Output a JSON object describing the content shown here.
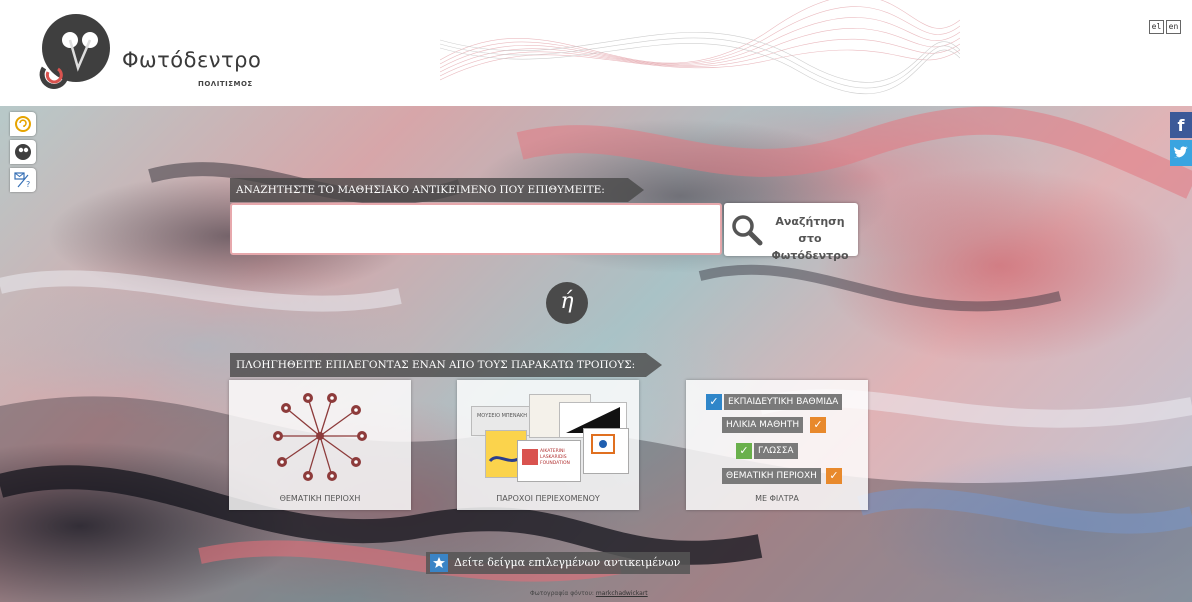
{
  "header": {
    "brand": "Φωτόδεντρο",
    "brand_sub": "ΠΟΛΙΤΙΣΜΟΣ",
    "lang_el": "el",
    "lang_en": "en"
  },
  "side_icons": [
    "help-circle-icon",
    "photodentro-icon",
    "feedback-icon"
  ],
  "social": {
    "facebook": "f",
    "twitter": "t"
  },
  "search": {
    "banner": "ΑΝΑΖΗΤΗΣΤΕ ΤΟ ΜΑΘΗΣΙΑΚΟ ΑΝΤΙΚΕΙΜΕΝΟ ΠΟΥ ΕΠΙΘΥΜΕΙΤΕ:",
    "input_value": "",
    "button_line1": "Αναζήτηση στο",
    "button_line2": "Φωτόδεντρο"
  },
  "or_label": "ή",
  "navigate": {
    "banner": "ΠΛΟΗΓΗΘΕΙΤΕ ΕΠΙΛΕΓΟΝΤΑΣ ΕΝΑΝ ΑΠΟ ΤΟΥΣ ΠΑΡΑΚΑΤΩ ΤΡΟΠΟΥΣ:",
    "cards": [
      {
        "caption": "ΘΕΜΑΤΙΚΗ ΠΕΡΙΟΧΗ"
      },
      {
        "caption": "ΠΑΡΟΧΟΙ ΠΕΡΙΕΧΟΜΕΝΟΥ",
        "logos": [
          "ΜΟΥΣΕΙΟ ΜΠΕΝΑΚΗ",
          "AIKATERINI LASKARIDIS FOUNDATION"
        ]
      },
      {
        "caption": "ΜΕ ΦΙΛΤΡΑ",
        "filters": [
          "ΕΚΠΑΙΔΕΥΤΙΚΗ ΒΑΘΜΙΔΑ",
          "ΗΛΙΚΙΑ ΜΑΘΗΤΗ",
          "ΓΛΩΣΣΑ",
          "ΘΕΜΑΤΙΚΗ ΠΕΡΙΟΧΗ"
        ]
      }
    ]
  },
  "samples_button": "Δείτε δείγμα επιλεγμένων αντικειμένων",
  "credit": {
    "prefix": "Φωτογραφία φόντου:",
    "author": "markchadwickart"
  },
  "colors": {
    "banner_bg": "#464646",
    "check_blue": "#2f86c9",
    "check_orange": "#e8892c",
    "check_green": "#6ab04c",
    "facebook": "#3b5998",
    "twitter": "#3aa4e0",
    "node": "#8d3b3b"
  }
}
